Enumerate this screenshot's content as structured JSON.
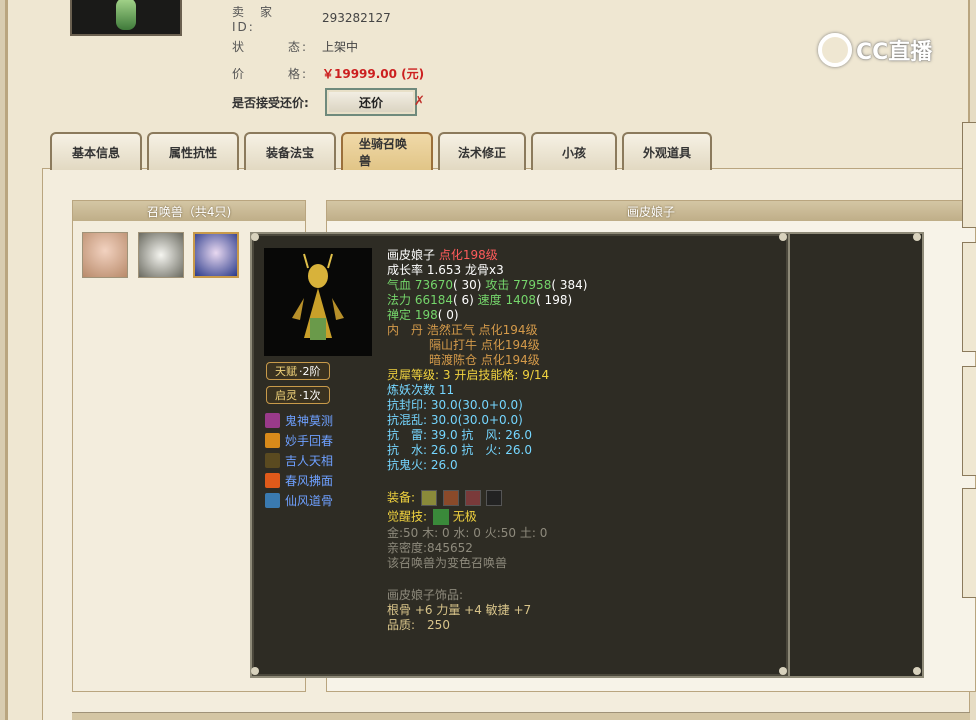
{
  "seller": {
    "id_label": "卖　家　　ID:",
    "id_value": "293282127",
    "status_label": "状　　　态:",
    "status_value": "上架中",
    "price_label": "价　　　格:",
    "price_value": "￥19999.00 (元)",
    "bargain_label": "是否接受还价:",
    "bargain_button": "还价"
  },
  "watermark": {
    "text": "CC直播"
  },
  "tabs": [
    {
      "label": "基本信息"
    },
    {
      "label": "属性抗性"
    },
    {
      "label": "装备法宝"
    },
    {
      "label": "坐骑召唤兽"
    },
    {
      "label": "法术修正"
    },
    {
      "label": "小孩"
    },
    {
      "label": "外观道具"
    }
  ],
  "summon_panel": {
    "title": "召唤兽（共4只)"
  },
  "detail_panel": {
    "title": "画皮娘子"
  },
  "tooltip": {
    "name": "画皮娘子",
    "name_tag": "点化198级",
    "growth": "成长率 1.653 龙骨x3",
    "hp_label": "气血",
    "hp_value": "73670",
    "hp_extra": "( 30)",
    "atk_label": "攻击",
    "atk_value": "77958",
    "atk_extra": "( 384)",
    "mp_label": "法力",
    "mp_value": "66184",
    "mp_extra": "( 6)",
    "spd_label": "速度",
    "spd_value": "1408",
    "spd_extra": "( 198)",
    "spirit_label": "禅定",
    "spirit_value": "198",
    "spirit_extra": "( 0)",
    "neidan_label": "内　丹",
    "neidan": [
      "浩然正气 点化194级",
      "隔山打牛 点化194级",
      "暗渡陈仓 点化194级"
    ],
    "lingxi_label": "灵犀等级:",
    "lingxi_value": "3",
    "lingxi_skill_label": "开启技能格:",
    "lingxi_skill_value": "9/14",
    "refine": "炼妖次数 11",
    "resist_seal": "抗封印: 30.0(30.0+0.0)",
    "resist_chaos": "抗混乱: 30.0(30.0+0.0)",
    "resist_thunder": "抗　雷: 39.0",
    "resist_wind": "抗　风: 26.0",
    "resist_water": "抗　水: 26.0",
    "resist_fire": "抗　火: 26.0",
    "resist_ghost": "抗鬼火: 26.0",
    "equip_label": "装备:",
    "awaken_label": "觉醒技:",
    "awaken_value": "无极",
    "elements": "金:50 木: 0 水: 0 火:50 土: 0",
    "intimacy": "亲密度:845652",
    "variant_note": "该召唤兽为变色召唤兽",
    "ornament_title": "画皮娘子饰品:",
    "ornament_stats": "根骨 +6 力量 +4 敏捷 +7",
    "quality": "品质:　250",
    "talent_label": "天赋",
    "talent_value": "·2阶",
    "qiling_label": "启灵",
    "qiling_value": "·1次",
    "skills": [
      {
        "name": "鬼神莫测",
        "icon": "ghost-skill-icon",
        "color": "#9a3a8a"
      },
      {
        "name": "妙手回春",
        "icon": "heal-skill-icon",
        "color": "#d88a1a"
      },
      {
        "name": "吉人天相",
        "icon": "lucky-skill-icon",
        "color": "#5a4a20"
      },
      {
        "name": "春风拂面",
        "icon": "breeze-skill-icon",
        "color": "#e05a1a"
      },
      {
        "name": "仙风道骨",
        "icon": "immortal-skill-icon",
        "color": "#3a7ab0"
      }
    ]
  },
  "colors": {
    "accent": "#c89a4a",
    "price": "#cc1f1f",
    "tooltip_bg": "#2e2c24",
    "green_stat": "#75d66b",
    "orange_neidan": "#d49a4a",
    "yellow_text": "#f1d33f"
  }
}
